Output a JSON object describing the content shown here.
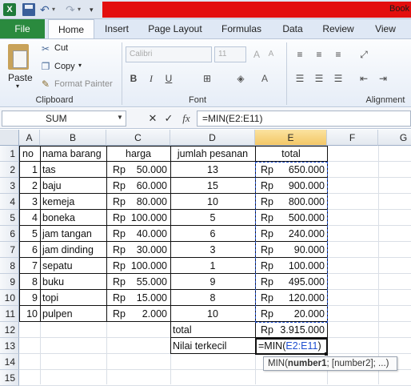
{
  "window": {
    "title": "Book"
  },
  "tabs": [
    "File",
    "Home",
    "Insert",
    "Page Layout",
    "Formulas",
    "Data",
    "Review",
    "View"
  ],
  "ribbon": {
    "clipboard": {
      "label": "Clipboard",
      "paste": "Paste",
      "cut": "Cut",
      "copy": "Copy",
      "format_painter": "Format Painter"
    },
    "font": {
      "label": "Font",
      "font_name": "Calibri",
      "font_size": "11"
    },
    "alignment": {
      "label": "Alignment"
    }
  },
  "formula_bar": {
    "name_box": "SUM",
    "cancel": "✕",
    "enter": "✓",
    "fx": "fx",
    "formula": "=MIN(E2:E11)"
  },
  "columns": [
    "A",
    "B",
    "C",
    "D",
    "E",
    "F",
    "G"
  ],
  "rows": [
    "1",
    "2",
    "3",
    "4",
    "5",
    "6",
    "7",
    "8",
    "9",
    "10",
    "11",
    "12",
    "13",
    "14",
    "15"
  ],
  "table": {
    "headers": {
      "no": "no",
      "nama": "nama barang",
      "harga": "harga",
      "jumlah": "jumlah pesanan",
      "total": "total"
    },
    "items": [
      {
        "no": "1",
        "nama": "tas",
        "harga_rp": "Rp",
        "harga": "50.000",
        "jumlah": "13",
        "total_rp": "Rp",
        "total": "650.000"
      },
      {
        "no": "2",
        "nama": "baju",
        "harga_rp": "Rp",
        "harga": "60.000",
        "jumlah": "15",
        "total_rp": "Rp",
        "total": "900.000"
      },
      {
        "no": "3",
        "nama": "kemeja",
        "harga_rp": "Rp",
        "harga": "80.000",
        "jumlah": "10",
        "total_rp": "Rp",
        "total": "800.000"
      },
      {
        "no": "4",
        "nama": "boneka",
        "harga_rp": "Rp",
        "harga": "100.000",
        "jumlah": "5",
        "total_rp": "Rp",
        "total": "500.000"
      },
      {
        "no": "5",
        "nama": "jam tangan",
        "harga_rp": "Rp",
        "harga": "40.000",
        "jumlah": "6",
        "total_rp": "Rp",
        "total": "240.000"
      },
      {
        "no": "6",
        "nama": "jam dinding",
        "harga_rp": "Rp",
        "harga": "30.000",
        "jumlah": "3",
        "total_rp": "Rp",
        "total": "90.000"
      },
      {
        "no": "7",
        "nama": "sepatu",
        "harga_rp": "Rp",
        "harga": "100.000",
        "jumlah": "1",
        "total_rp": "Rp",
        "total": "100.000"
      },
      {
        "no": "8",
        "nama": "buku",
        "harga_rp": "Rp",
        "harga": "55.000",
        "jumlah": "9",
        "total_rp": "Rp",
        "total": "495.000"
      },
      {
        "no": "9",
        "nama": "topi",
        "harga_rp": "Rp",
        "harga": "15.000",
        "jumlah": "8",
        "total_rp": "Rp",
        "total": "120.000"
      },
      {
        "no": "10",
        "nama": "pulpen",
        "harga_rp": "Rp",
        "harga": "2.000",
        "jumlah": "10",
        "total_rp": "Rp",
        "total": "20.000"
      }
    ],
    "total_label": "total",
    "total_rp": "Rp",
    "total_value": "3.915.000",
    "min_label": "Nilai terkecil",
    "min_formula_prefix": "=MIN(",
    "min_formula_range": "E2:E11",
    "min_formula_suffix": ")"
  },
  "tooltip": {
    "fn": "MIN(",
    "arg1": "number1",
    "rest": "; [number2]; ...)"
  },
  "colors": {
    "file_tab": "#2a8a3e",
    "title_bar_red": "#e30e0e",
    "selected_header": "#f3c766",
    "range_ref": "#1f4fd0"
  }
}
